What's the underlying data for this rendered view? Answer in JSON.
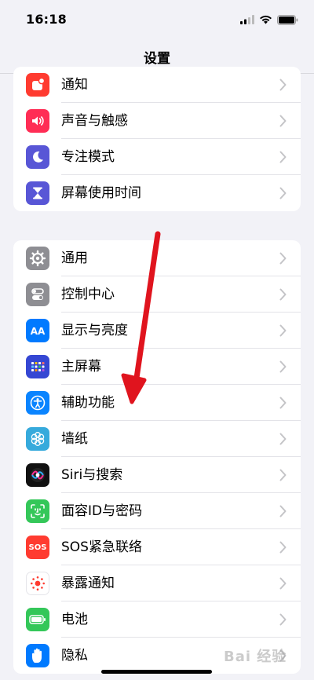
{
  "status": {
    "time": "16:18"
  },
  "nav": {
    "title": "设置"
  },
  "group1": [
    {
      "label": "通知",
      "icon": "notifications-icon",
      "color": "#ff3b30"
    },
    {
      "label": "声音与触感",
      "icon": "sound-icon",
      "color": "#ff2d55"
    },
    {
      "label": "专注模式",
      "icon": "focus-moon-icon",
      "color": "#5856d6"
    },
    {
      "label": "屏幕使用时间",
      "icon": "screen-time-hourglass-icon",
      "color": "#5856d6"
    }
  ],
  "group2": [
    {
      "label": "通用",
      "icon": "gear-icon",
      "color": "#8e8e93"
    },
    {
      "label": "控制中心",
      "icon": "control-center-icon",
      "color": "#8e8e93"
    },
    {
      "label": "显示与亮度",
      "icon": "display-aa-icon",
      "color": "#007aff"
    },
    {
      "label": "主屏幕",
      "icon": "home-screen-icon",
      "color": "#3547d3"
    },
    {
      "label": "辅助功能",
      "icon": "accessibility-icon",
      "color": "#0a84ff"
    },
    {
      "label": "墙纸",
      "icon": "wallpaper-flower-icon",
      "color": "#36aadc"
    },
    {
      "label": "Siri与搜索",
      "icon": "siri-icon",
      "color": "#111111"
    },
    {
      "label": "面容ID与密码",
      "icon": "face-id-icon",
      "color": "#34c759"
    },
    {
      "label": "SOS紧急联络",
      "icon": "sos-icon",
      "color": "#ff3b30"
    },
    {
      "label": "暴露通知",
      "icon": "exposure-notification-icon",
      "color": "#ffffff"
    },
    {
      "label": "电池",
      "icon": "battery-icon",
      "color": "#34c759"
    },
    {
      "label": "隐私",
      "icon": "privacy-hand-icon",
      "color": "#007aff"
    }
  ],
  "icons": {
    "sos_text": "SOS"
  },
  "watermark": {
    "text": "Bai 经验"
  },
  "annotation": {
    "color": "#e0141e"
  }
}
